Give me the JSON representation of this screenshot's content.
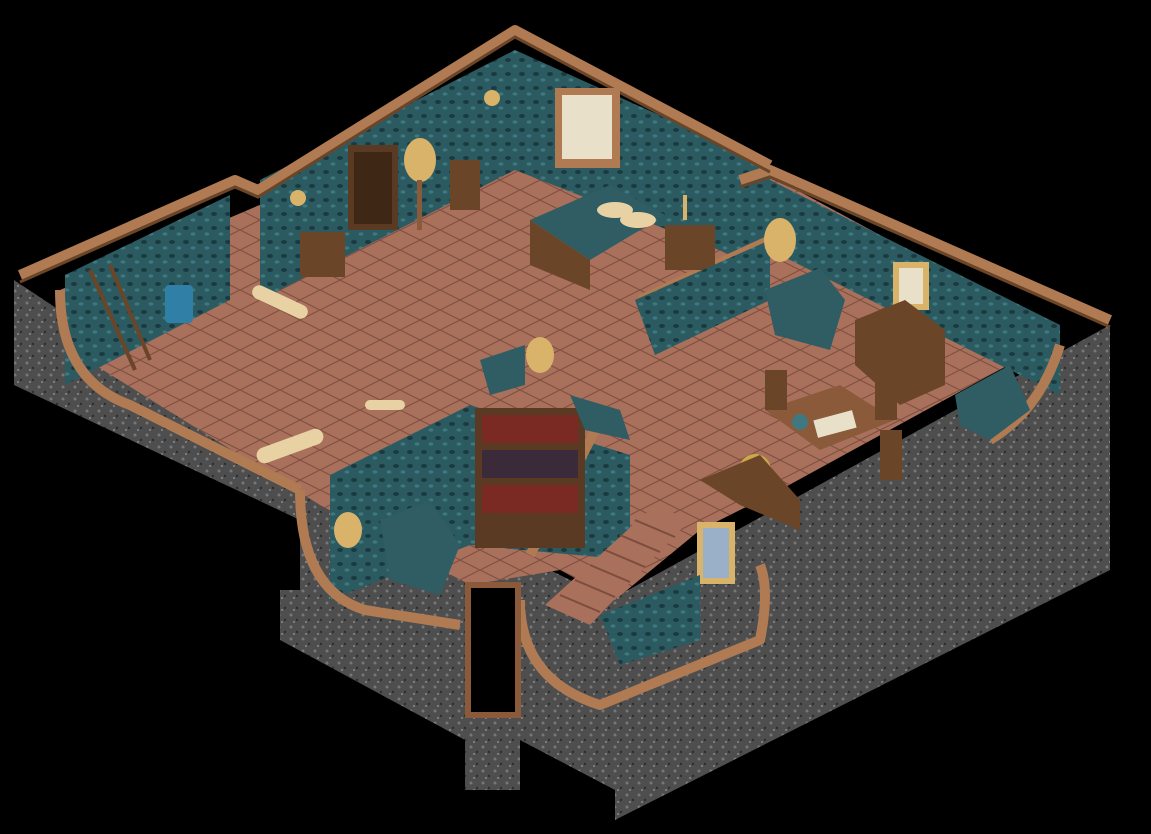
{
  "scene": {
    "kind": "isometric-house-cutaway",
    "background": "#000000",
    "colors": {
      "wall_wallpaper": "#2c5a61",
      "wall_wallpaper_dark": "#1a3a40",
      "wall_trim": "#8a5a3b",
      "wall_trim_light": "#b07a52",
      "floor_tile": "#a9705c",
      "floor_tile_grout": "#7c4d3d",
      "stone_side": "#5a5a5a",
      "wood_furniture": "#6b4527",
      "upholstery": "#2f5d63",
      "lamp_gold": "#d9b36a"
    },
    "rooms": [
      {
        "id": "storage-room",
        "contents": [
          "ladder",
          "paint-bucket",
          "wallpaper-rolls"
        ]
      },
      {
        "id": "hallway",
        "contents": [
          "wall-sconce",
          "lamp",
          "door",
          "chair"
        ]
      },
      {
        "id": "bedroom",
        "contents": [
          "bed",
          "window-with-curtains",
          "nightstand",
          "candle"
        ]
      },
      {
        "id": "living-room",
        "contents": [
          "armchair",
          "floor-lamp",
          "sideboard",
          "framed-picture",
          "dining-table",
          "chairs",
          "open-book",
          "flower-vase"
        ]
      },
      {
        "id": "library",
        "contents": [
          "bookshelf",
          "armchair",
          "table-lamp"
        ]
      },
      {
        "id": "stair-landing",
        "contents": [
          "staircase",
          "framed-portrait"
        ]
      }
    ]
  }
}
